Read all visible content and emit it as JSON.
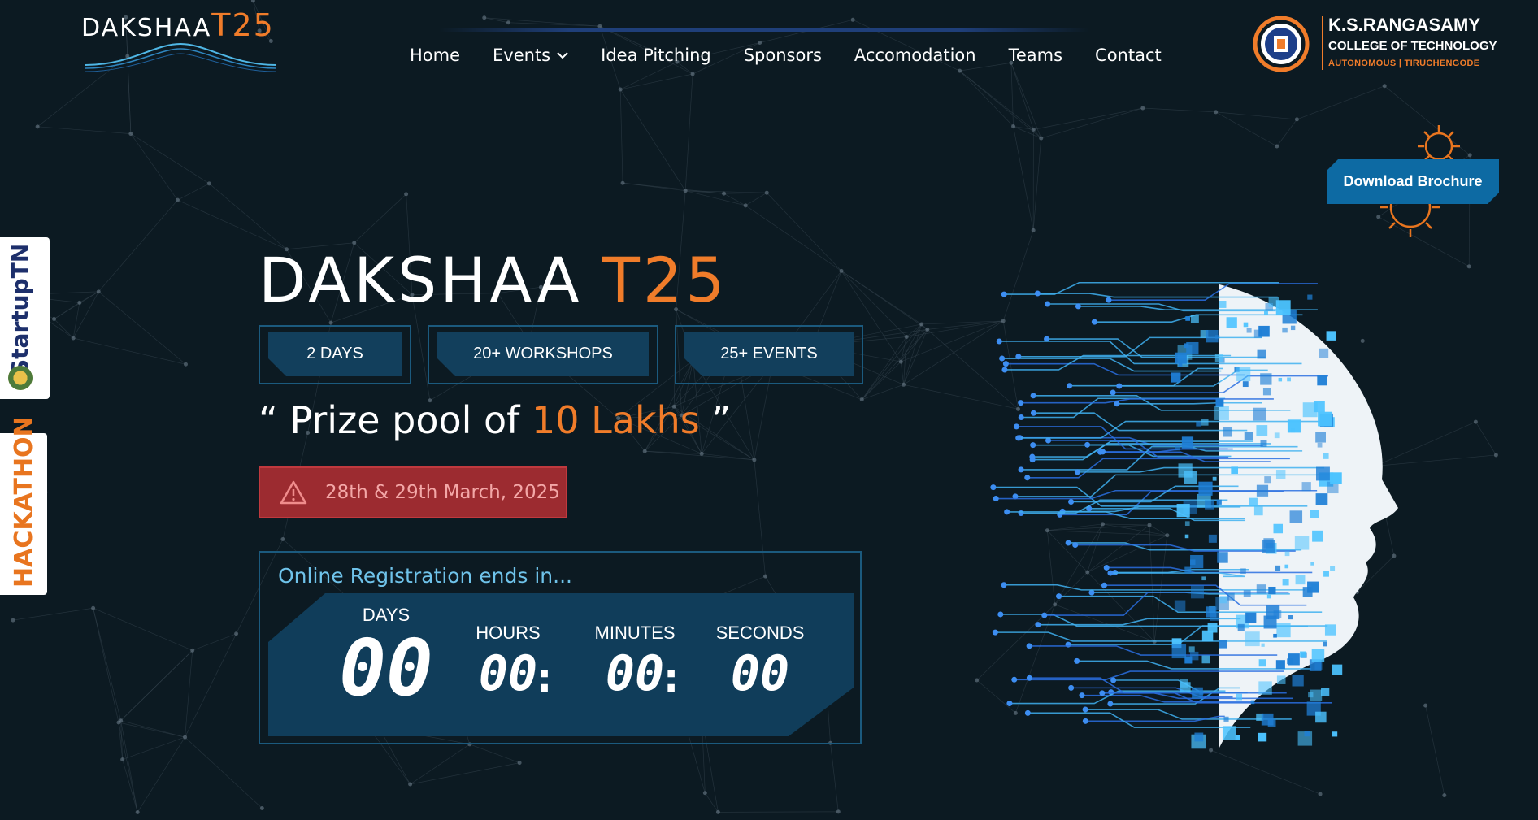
{
  "brand": {
    "logo_main": "DAKSHAA",
    "logo_accent": "T25"
  },
  "nav": {
    "items": [
      "Home",
      "Events",
      "Idea Pitching",
      "Sponsors",
      "Accomodation",
      "Teams",
      "Contact"
    ]
  },
  "college": {
    "name": "K.S.RANGASAMY",
    "subtitle": "COLLEGE OF TECHNOLOGY",
    "tagline": "AUTONOMOUS | TIRUCHENGODE"
  },
  "brochure_button": "Download Brochure",
  "side_badges": {
    "startup": "StartupTN",
    "hackathon": "HACKATHON"
  },
  "hero": {
    "title_main": "DAKSHAA",
    "title_accent": "T25",
    "stats": [
      "2 DAYS",
      "20+ WORKSHOPS",
      "25+ EVENTS"
    ],
    "prize_open": "“ Prize pool of ",
    "prize_amount": "10 Lakhs",
    "prize_close": " ”",
    "date": "28th & 29th March, 2025"
  },
  "countdown": {
    "title": "Online Registration ends in...",
    "units": [
      {
        "label": "DAYS",
        "value": "00"
      },
      {
        "label": "HOURS",
        "value": "00"
      },
      {
        "label": "MINUTES",
        "value": "00"
      },
      {
        "label": "SECONDS",
        "value": "00"
      }
    ],
    "separator": ":"
  },
  "colors": {
    "background": "#0c1a22",
    "accent_orange": "#f07c2a",
    "brochure_blue": "#0d6aa3",
    "panel_blue": "#123f5c",
    "alert_red": "#9c2b30",
    "countdown_title": "#6fc3ea"
  },
  "icons": {
    "nav_events": "chevron-down-icon",
    "date_alert": "warning-triangle-icon",
    "brochure_deco": "gear-icon"
  }
}
